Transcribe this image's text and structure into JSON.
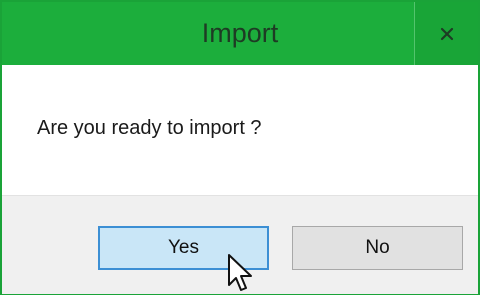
{
  "dialog": {
    "title": "Import",
    "close_label": "x",
    "message": "Are you ready to import ?",
    "buttons": {
      "yes_label": "Yes",
      "no_label": "No"
    }
  },
  "colors": {
    "titlebar": "#1cae3c",
    "border": "#1aa338",
    "yes_button_bg": "#c9e6f7",
    "yes_button_border": "#3c8fd4",
    "no_button_bg": "#e1e1e1"
  },
  "icons": {
    "close": "close-icon",
    "cursor": "mouse-pointer-icon"
  }
}
